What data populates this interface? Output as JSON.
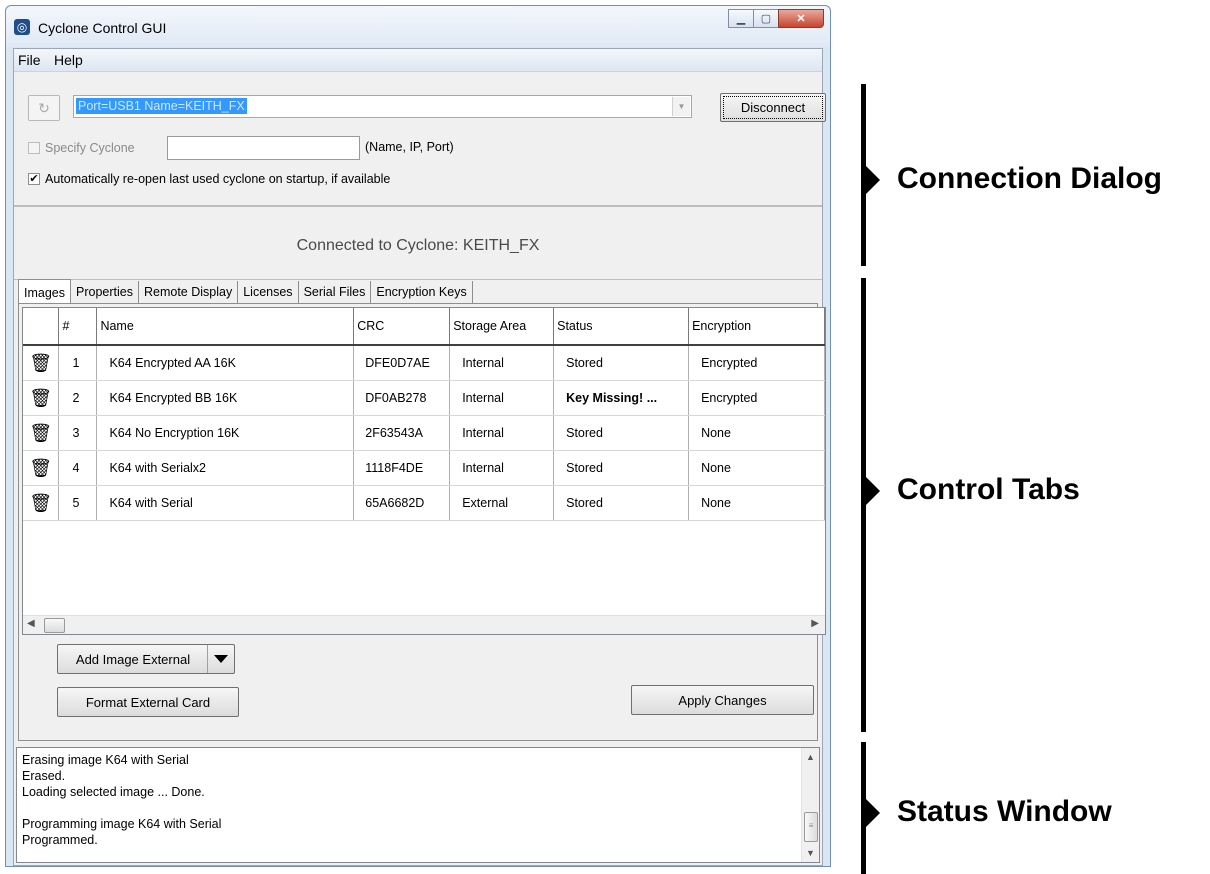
{
  "window": {
    "title": "Cyclone Control GUI",
    "menu": [
      "File",
      "Help"
    ]
  },
  "connection": {
    "port_value": "Port=USB1   Name=KEITH_FX",
    "disconnect_label": "Disconnect",
    "specify_label": "Specify Cyclone",
    "specify_hint": "(Name, IP, Port)",
    "specify_checked": false,
    "auto_reopen_label": "Automatically re-open last used cyclone on startup, if available",
    "auto_reopen_checked": true,
    "connected_text": "Connected to Cyclone: KEITH_FX"
  },
  "tabs": [
    "Images",
    "Properties",
    "Remote Display",
    "Licenses",
    "Serial Files",
    "Encryption Keys"
  ],
  "active_tab": "Images",
  "images_table": {
    "columns": [
      "",
      "#",
      "Name",
      "CRC",
      "Storage Area",
      "Status",
      "Encryption"
    ],
    "rows": [
      {
        "num": "1",
        "name": "K64 Encrypted AA 16K",
        "crc": "DFE0D7AE",
        "storage": "Internal",
        "status": "Stored",
        "encryption": "Encrypted"
      },
      {
        "num": "2",
        "name": "K64 Encrypted BB 16K",
        "crc": "DF0AB278",
        "storage": "Internal",
        "status": "Key Missing! ...",
        "encryption": "Encrypted"
      },
      {
        "num": "3",
        "name": "K64 No Encryption 16K",
        "crc": "2F63543A",
        "storage": "Internal",
        "status": "Stored",
        "encryption": "None"
      },
      {
        "num": "4",
        "name": "K64 with Serialx2",
        "crc": "1118F4DE",
        "storage": "Internal",
        "status": "Stored",
        "encryption": "None"
      },
      {
        "num": "5",
        "name": "K64 with Serial",
        "crc": "65A6682D",
        "storage": "External",
        "status": "Stored",
        "encryption": "None"
      }
    ]
  },
  "buttons": {
    "add_image": "Add Image External",
    "format_card": "Format External Card",
    "apply_changes": "Apply Changes"
  },
  "status_lines": [
    "Erasing image K64 with Serial",
    "Erased.",
    "Loading selected image ... Done.",
    "",
    "Programming image K64 with Serial",
    "Programmed."
  ],
  "annotations": {
    "connection": "Connection Dialog",
    "control": "Control Tabs",
    "status": "Status Window"
  },
  "colors": {
    "selection": "#3399ff",
    "titlebar": "#dfe9f5",
    "close_button": "#c7452f"
  }
}
